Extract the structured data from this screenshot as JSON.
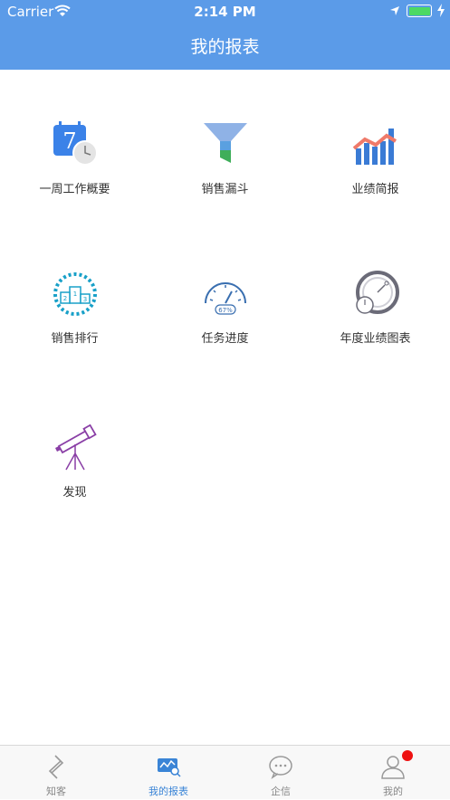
{
  "status": {
    "carrier": "Carrier",
    "time": "2:14 PM"
  },
  "header": {
    "title": "我的报表"
  },
  "grid": [
    {
      "label": "一周工作概要",
      "icon": "calendar-clock-icon"
    },
    {
      "label": "销售漏斗",
      "icon": "funnel-icon"
    },
    {
      "label": "业绩简报",
      "icon": "bar-trend-icon"
    },
    {
      "label": "销售排行",
      "icon": "podium-laurel-icon"
    },
    {
      "label": "任务进度",
      "icon": "gauge-icon",
      "gauge_text": "67%"
    },
    {
      "label": "年度业绩图表",
      "icon": "dial-icon"
    },
    {
      "label": "发现",
      "icon": "telescope-icon"
    }
  ],
  "tabbar": {
    "items": [
      {
        "label": "知客",
        "icon": "diamond-logo-icon"
      },
      {
        "label": "我的报表",
        "icon": "report-icon",
        "active": true
      },
      {
        "label": "企信",
        "icon": "chat-icon"
      },
      {
        "label": "我的",
        "icon": "user-icon",
        "badge": true
      }
    ]
  },
  "colors": {
    "header": "#5b9be8",
    "active_tab": "#3a84d6",
    "badge": "#ee1111"
  }
}
